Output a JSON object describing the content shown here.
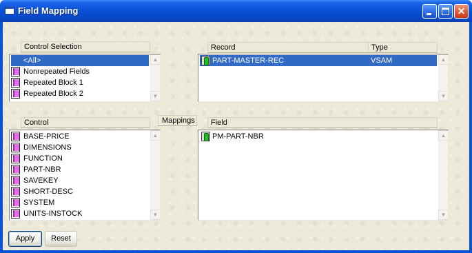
{
  "window": {
    "title": "Field Mapping"
  },
  "control_selection": {
    "header": "Control Selection",
    "items": [
      {
        "label": "<All>",
        "selected": true,
        "icon": "none"
      },
      {
        "label": "Nonrepeated Fields",
        "icon": "pink-block-icon"
      },
      {
        "label": "Repeated Block 1",
        "icon": "pink-block-icon"
      },
      {
        "label": "Repeated Block 2",
        "icon": "pink-block-icon"
      }
    ]
  },
  "records": {
    "header_record": "Record",
    "header_type": "Type",
    "rows": [
      {
        "record": "PART-MASTER-REC",
        "type": "VSAM",
        "selected": true,
        "icon": "green-light-icon"
      }
    ]
  },
  "controls": {
    "header": "Control",
    "items": [
      "BASE-PRICE",
      "DIMENSIONS",
      "FUNCTION",
      "PART-NBR",
      "SAVEKEY",
      "SHORT-DESC",
      "SYSTEM",
      "UNITS-INSTOCK"
    ]
  },
  "mappings": {
    "label": "Mappings"
  },
  "fields": {
    "header": "Field",
    "items": [
      "PM-PART-NBR"
    ]
  },
  "buttons": {
    "apply": "Apply",
    "reset": "Reset"
  },
  "colors": {
    "titlebar": "#0a52d8",
    "selection": "#316ac5",
    "client": "#ece9d8",
    "close_button": "#e05430"
  }
}
